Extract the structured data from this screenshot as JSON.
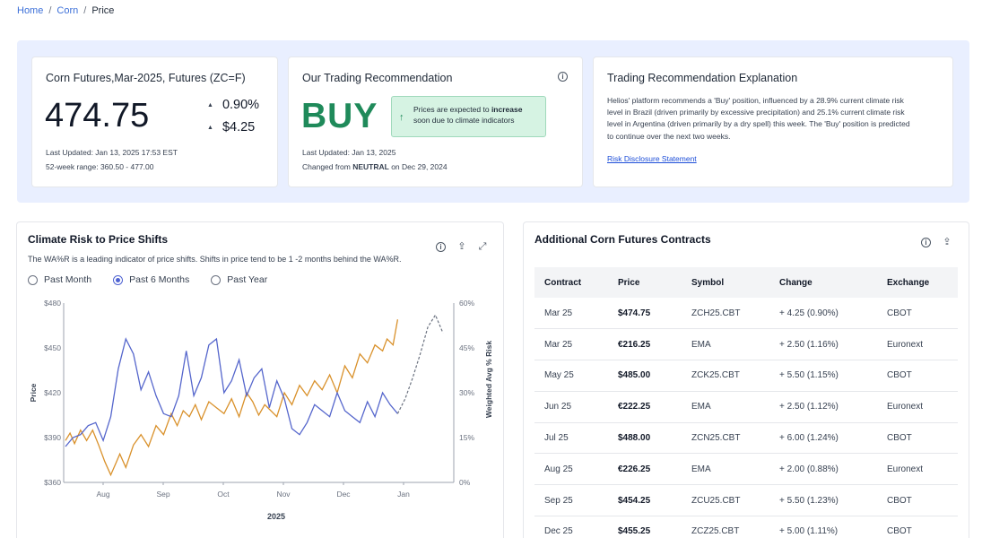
{
  "breadcrumb": {
    "home": "Home",
    "corn": "Corn",
    "current": "Price"
  },
  "futures_card": {
    "title": "Corn Futures,Mar-2025, Futures (ZC=F)",
    "price": "474.75",
    "change_pct": "0.90%",
    "change_abs": "$4.25",
    "last_updated": "Last Updated: Jan 13, 2025 17:53 EST",
    "range": "52-week range: 360.50 - 477.00"
  },
  "recommendation_card": {
    "title": "Our Trading Recommendation",
    "signal": "BUY",
    "note_pre": "Prices are expected to ",
    "note_bold": "increase",
    "note_post": "soon due to climate indicators",
    "last_updated": "Last Updated: Jan 13, 2025",
    "changed_pre": "Changed from ",
    "changed_bold": "NEUTRAL",
    "changed_post": " on Dec 29, 2024",
    "signal_color": "#1f8a5a"
  },
  "explanation_card": {
    "title": "Trading Recommendation Explanation",
    "body": "Helios' platform recommends a 'Buy' position, influenced by a 28.9% current climate risk level in Brazil (driven primarily by excessive precipitation) and 25.1% current climate risk level in Argentina (driven primarily by a dry spell) this week. The 'Buy' position is predicted to continue over the next two weeks.",
    "link": "Risk Disclosure Statement"
  },
  "climate_chart": {
    "title": "Climate Risk to Price Shifts",
    "subtitle": "The WA%R is a leading indicator of price shifts. Shifts in price tend to be 1 -2 months behind the WA%R.",
    "radios": [
      "Past Month",
      "Past 6 Months",
      "Past Year"
    ],
    "selected_radio": 1
  },
  "chart_data": {
    "type": "line",
    "x_ticks": [
      "Aug",
      "Sep",
      "Oct",
      "Nov",
      "Dec",
      "Jan"
    ],
    "xlabel": "2025",
    "ylabel": "Price",
    "y2label": "Weighted Avg % Risk",
    "y_ticks": [
      "$360",
      "$390",
      "$420",
      "$450",
      "$480"
    ],
    "y2_ticks": [
      "0%",
      "15%",
      "30%",
      "45%",
      "60%"
    ],
    "ylim": [
      360,
      480
    ],
    "y2lim": [
      0,
      60
    ],
    "series": [
      {
        "color": "#d9912b",
        "axis": "left",
        "points": [
          [
            0,
            388
          ],
          [
            0.3,
            393
          ],
          [
            0.6,
            386
          ],
          [
            1,
            395
          ],
          [
            1.4,
            388
          ],
          [
            1.8,
            395
          ],
          [
            2.2,
            385
          ],
          [
            2.6,
            374
          ],
          [
            3.0,
            365
          ],
          [
            3.3,
            372
          ],
          [
            3.6,
            379
          ],
          [
            4.0,
            370
          ],
          [
            4.5,
            385
          ],
          [
            5.0,
            392
          ],
          [
            5.5,
            384
          ],
          [
            6.0,
            398
          ],
          [
            6.5,
            392
          ],
          [
            7.0,
            406
          ],
          [
            7.4,
            398
          ],
          [
            7.8,
            408
          ],
          [
            8.2,
            404
          ],
          [
            8.6,
            412
          ],
          [
            9.0,
            402
          ],
          [
            9.5,
            414
          ],
          [
            10.0,
            410
          ],
          [
            10.5,
            406
          ],
          [
            11.0,
            416
          ],
          [
            11.5,
            404
          ],
          [
            12.0,
            420
          ],
          [
            12.4,
            414
          ],
          [
            12.8,
            405
          ],
          [
            13.2,
            412
          ],
          [
            13.6,
            408
          ],
          [
            14.0,
            404
          ],
          [
            14.5,
            420
          ],
          [
            15.0,
            412
          ],
          [
            15.5,
            425
          ],
          [
            16.0,
            418
          ],
          [
            16.5,
            428
          ],
          [
            17.0,
            422
          ],
          [
            17.5,
            432
          ],
          [
            18.0,
            420
          ],
          [
            18.5,
            438
          ],
          [
            19.0,
            430
          ],
          [
            19.5,
            446
          ],
          [
            20.0,
            440
          ],
          [
            20.5,
            452
          ],
          [
            21.0,
            448
          ],
          [
            21.3,
            456
          ],
          [
            21.7,
            452
          ],
          [
            22.0,
            469
          ]
        ]
      },
      {
        "color": "#5566cc",
        "axis": "right",
        "points": [
          [
            0,
            12
          ],
          [
            0.5,
            15
          ],
          [
            1,
            16
          ],
          [
            1.5,
            19
          ],
          [
            2,
            20
          ],
          [
            2.5,
            14
          ],
          [
            3,
            22
          ],
          [
            3.5,
            38
          ],
          [
            4,
            48
          ],
          [
            4.5,
            43
          ],
          [
            5,
            31
          ],
          [
            5.5,
            37
          ],
          [
            6,
            29
          ],
          [
            6.5,
            23
          ],
          [
            7,
            22
          ],
          [
            7.5,
            29
          ],
          [
            8,
            44
          ],
          [
            8.5,
            29
          ],
          [
            9,
            35
          ],
          [
            9.5,
            46
          ],
          [
            10,
            48
          ],
          [
            10.5,
            30
          ],
          [
            11,
            34
          ],
          [
            11.5,
            41
          ],
          [
            12,
            29
          ],
          [
            12.5,
            35
          ],
          [
            13,
            38
          ],
          [
            13.5,
            25
          ],
          [
            14,
            34
          ],
          [
            14.5,
            28
          ],
          [
            15,
            18
          ],
          [
            15.5,
            16
          ],
          [
            16,
            20
          ],
          [
            16.5,
            26
          ],
          [
            17,
            24
          ],
          [
            17.5,
            22
          ],
          [
            18,
            30
          ],
          [
            18.5,
            24
          ],
          [
            19,
            22
          ],
          [
            19.5,
            20
          ],
          [
            20,
            27
          ],
          [
            20.5,
            22
          ],
          [
            21,
            30
          ],
          [
            21.5,
            26
          ],
          [
            22,
            23
          ],
          [
            22.5,
            28
          ],
          [
            23,
            35
          ],
          [
            23.5,
            43
          ],
          [
            24,
            52
          ],
          [
            24.5,
            56
          ],
          [
            25,
            50
          ]
        ]
      }
    ],
    "forecast_from_index": 44
  },
  "contracts": {
    "title": "Additional Corn Futures Contracts",
    "headers": [
      "Contract",
      "Price",
      "Symbol",
      "Change",
      "Exchange"
    ],
    "rows": [
      [
        "Mar 25",
        "$474.75",
        "ZCH25.CBT",
        "+ 4.25 (0.90%)",
        "CBOT"
      ],
      [
        "Mar 25",
        "€216.25",
        "EMA",
        "+ 2.50 (1.16%)",
        "Euronext"
      ],
      [
        "May 25",
        "$485.00",
        "ZCK25.CBT",
        "+ 5.50 (1.15%)",
        "CBOT"
      ],
      [
        "Jun 25",
        "€222.25",
        "EMA",
        "+ 2.50 (1.12%)",
        "Euronext"
      ],
      [
        "Jul 25",
        "$488.00",
        "ZCN25.CBT",
        "+ 6.00 (1.24%)",
        "CBOT"
      ],
      [
        "Aug 25",
        "€226.25",
        "EMA",
        "+ 2.00 (0.88%)",
        "Euronext"
      ],
      [
        "Sep 25",
        "$454.25",
        "ZCU25.CBT",
        "+ 5.50 (1.23%)",
        "CBOT"
      ],
      [
        "Dec 25",
        "$455.25",
        "ZCZ25.CBT",
        "+ 5.00 (1.11%)",
        "CBOT"
      ]
    ]
  }
}
